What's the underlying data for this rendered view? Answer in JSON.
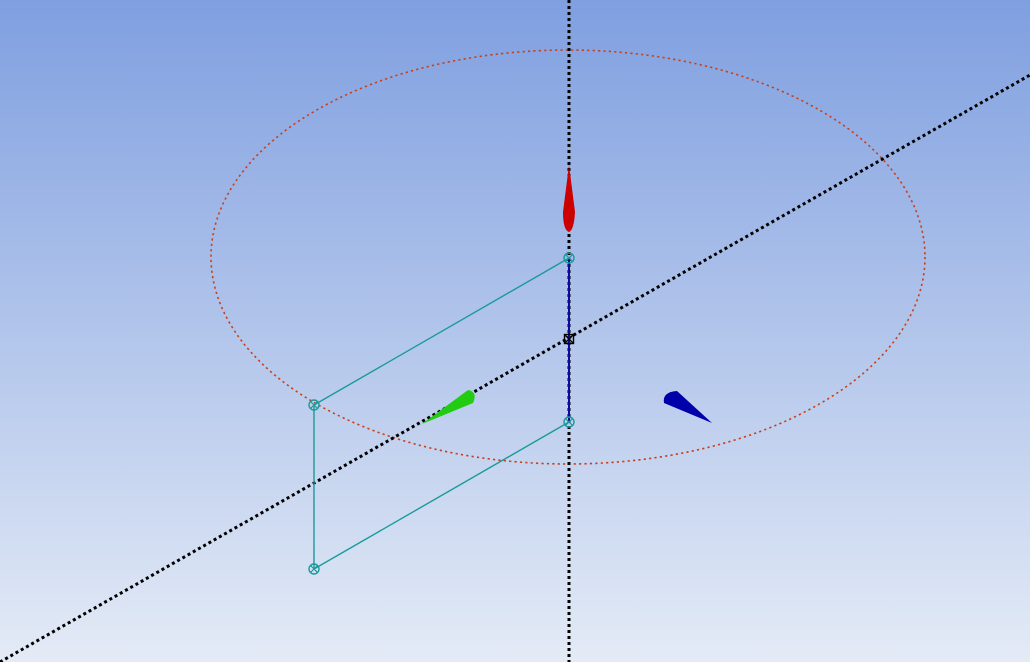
{
  "viewport": {
    "background_top": "#7f9fe0",
    "background_bottom": "#e4ebf6"
  },
  "colors": {
    "axis_lines": "#000000",
    "revolve_path": "#c8401a",
    "sketch": "#1a9a9a",
    "origin": "#000000",
    "triad_x": "#22cc11",
    "triad_y": "#cc0000",
    "triad_z": "#0000aa",
    "z_axis_line": "#0a0aa0"
  },
  "icons": {
    "origin": "origin-point-icon",
    "x_arrow": "x-axis-arrow-icon",
    "y_arrow": "y-axis-arrow-icon",
    "z_arrow": "z-axis-arrow-icon"
  }
}
